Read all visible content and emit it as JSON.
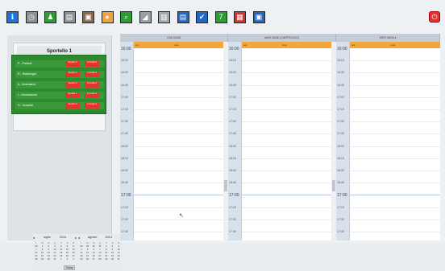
{
  "toolbar": {
    "icons": [
      {
        "name": "info-icon",
        "glyph": "ℹ",
        "color": "#1b74d8"
      },
      {
        "name": "clock-icon",
        "glyph": "◷",
        "color": "#8a8f95"
      },
      {
        "name": "people-icon",
        "glyph": "♟",
        "color": "#2f9b35"
      },
      {
        "name": "printer-icon",
        "glyph": "▤",
        "color": "#8b9095"
      },
      {
        "name": "book-icon",
        "glyph": "▣",
        "color": "#8a6b45"
      },
      {
        "name": "sun-icon",
        "glyph": "●",
        "color": "#f3a23a"
      },
      {
        "name": "search-icon",
        "glyph": "⌕",
        "color": "#2f9b35"
      },
      {
        "name": "chart-icon",
        "glyph": "◢",
        "color": "#9aa0a6"
      },
      {
        "name": "trash-icon",
        "glyph": "▥",
        "color": "#a3a8ad"
      },
      {
        "name": "document-icon",
        "glyph": "▤",
        "color": "#1f67c9"
      },
      {
        "name": "checkbox-icon",
        "glyph": "✔",
        "color": "#1f67c9"
      },
      {
        "name": "calendar-7-icon",
        "glyph": "7",
        "color": "#2f9b35"
      },
      {
        "name": "calendar-red-icon",
        "glyph": "▦",
        "color": "#d9342b"
      },
      {
        "name": "save-icon",
        "glyph": "▣",
        "color": "#1f67c9"
      }
    ],
    "close_glyph": "⏻"
  },
  "sportello": {
    "title": "Sportello 1",
    "tiles": [
      "P",
      "2"
    ]
  },
  "queues": [
    {
      "label": "P - Prelievi",
      "btn1": "Servito 0",
      "btn2": "In Coda 0"
    },
    {
      "label": "R - Radiologia",
      "btn1": "Servito 0",
      "btn2": "In Coda 0"
    },
    {
      "label": "A - Ambulatori",
      "btn1": "Servito 0",
      "btn2": "In Coda 0"
    },
    {
      "label": "I - Informazioni",
      "btn1": "Servito 1",
      "btn2": "In Coda 0"
    },
    {
      "label": "H - Hospital",
      "btn1": "Servito 0",
      "btn2": "In Coda 0"
    }
  ],
  "calendar": {
    "months": [
      {
        "name": "luglio",
        "year": "2014",
        "days": [
          "l",
          "m",
          "m",
          "g",
          "v",
          "s",
          "d",
          "30",
          "1",
          "2",
          "3",
          "4",
          "5",
          "6",
          "7",
          "8",
          "9",
          "10",
          "11",
          "12",
          "13",
          "14",
          "15",
          "16",
          "17",
          "18",
          "19",
          "20",
          "21",
          "22",
          "23",
          "24",
          "25",
          "26",
          "27",
          "28",
          "29",
          "30",
          "31",
          "1",
          "2",
          "3"
        ]
      },
      {
        "name": "agosto",
        "year": "2014",
        "days": [
          "l",
          "m",
          "m",
          "g",
          "v",
          "s",
          "d",
          "28",
          "29",
          "30",
          "31",
          "1",
          "2",
          "3",
          "4",
          "5",
          "6",
          "7",
          "8",
          "9",
          "10",
          "11",
          "12",
          "13",
          "14",
          "15",
          "16",
          "17",
          "18",
          "19",
          "20",
          "21",
          "22",
          "23",
          "24",
          "25",
          "26",
          "27",
          "28",
          "29",
          "30",
          "31"
        ]
      }
    ],
    "today_label": "Today"
  },
  "columns": [
    {
      "header": "LUN 04/08",
      "times": [
        "16:00",
        "16:15",
        "16:30",
        "16:45",
        "17:00",
        "17:15",
        "17:30",
        "17:45",
        "18:00",
        "18:15",
        "18:30",
        "18:45",
        "17:00",
        "17:15",
        "17:30",
        "17:45"
      ]
    },
    {
      "header": "MAR 05/08 (CARTEGGIO)",
      "times": [
        "16:00",
        "16:15",
        "16:30",
        "16:45",
        "17:00",
        "17:15",
        "17:30",
        "17:45",
        "18:00",
        "18:15",
        "18:30",
        "18:45",
        "17:00",
        "17:15",
        "17:30",
        "17:45"
      ]
    },
    {
      "header": "MER 06/08 ♦",
      "times": [
        "16:00",
        "16:15",
        "16:30",
        "16:45",
        "17:00",
        "17:15",
        "17:30",
        "17:45",
        "18:00",
        "18:15",
        "18:30",
        "18:45",
        "17:00",
        "17:15",
        "17:30",
        "17:45"
      ]
    }
  ],
  "day_header_labels": [
    "ora",
    "note"
  ]
}
